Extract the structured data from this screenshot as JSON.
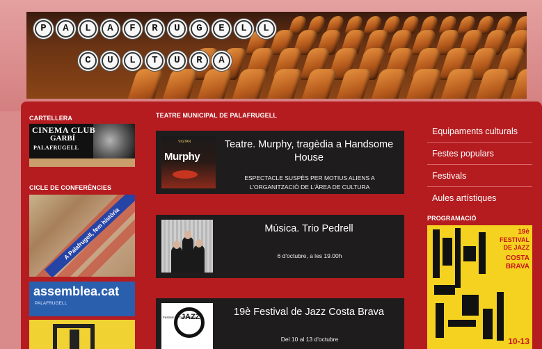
{
  "header": {
    "logo_row1": [
      "P",
      "A",
      "L",
      "A",
      "F",
      "R",
      "U",
      "G",
      "E",
      "L",
      "L"
    ],
    "logo_row2": [
      "C",
      "U",
      "L",
      "T",
      "U",
      "R",
      "A"
    ]
  },
  "left": {
    "cartellera_title": "CARTELLERA",
    "cinema_club": {
      "line1": "CINEMA CLUB",
      "line2": "GARBÍ",
      "line3": "PALAFRUGELL"
    },
    "cicle_title": "CICLE DE CONFERÈNCIES",
    "cicle_banner": "A Palafrugell, fem història",
    "assemblea": {
      "name": "assemblea.cat",
      "sub": "PALAFRUGELL"
    }
  },
  "center": {
    "section_title": "TEATRE MUNICIPAL DE PALAFRUGELL",
    "events": [
      {
        "title": "Teatre. Murphy, tragèdia a Handsome House",
        "subtitle": "ESPECTACLE SUSPÈS PER MOTIUS ALIENS A L'ORGANITZACIÓ DE L'ÀREA DE CULTURA",
        "thumb_text": "Murphy",
        "thumb_small": "VIGTAN"
      },
      {
        "title": "Música. Trio Pedrell",
        "subtitle": "6 d'octubre, a les 19.00h"
      },
      {
        "title": "19è Festival de Jazz Costa Brava",
        "subtitle": "Del 10 al 13 d'octubre",
        "thumb_text": "JAZZ",
        "thumb_small": "Festival de Costa Brava"
      }
    ]
  },
  "right": {
    "menu": [
      "Equipaments culturals",
      "Festes populars",
      "Festivals",
      "Aules artístiques"
    ],
    "programacio_title": "PROGRAMACIÓ",
    "poster": {
      "number": "19è",
      "line1": "FESTIVAL",
      "line2": "DE JAZZ",
      "line3": "COSTA",
      "line4": "BRAVA",
      "dates": "10-13"
    }
  }
}
